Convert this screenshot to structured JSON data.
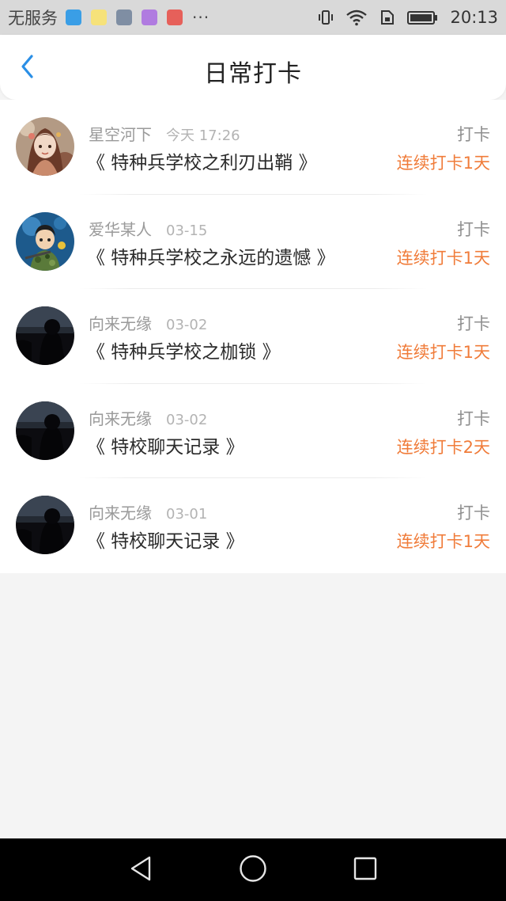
{
  "status_bar": {
    "carrier": "无服务",
    "more": "···",
    "time": "20:13",
    "app_icons": [
      {
        "name": "health-app-icon",
        "color": "#3a9ee6"
      },
      {
        "name": "ai-assistant-app-icon",
        "color": "#f6e27a"
      },
      {
        "name": "gallery-app-icon",
        "color": "#7f8ea3"
      },
      {
        "name": "keyboard-app-icon",
        "color": "#b07be0"
      },
      {
        "name": "red-app-icon",
        "color": "#e6605a"
      }
    ]
  },
  "header": {
    "title": "日常打卡",
    "back_icon": "chevron-left-icon",
    "accent_color": "#2b8fe6"
  },
  "colors": {
    "streak": "#f07c3a",
    "title": "#2b2b2b",
    "meta": "#9a9a9a"
  },
  "entries": [
    {
      "username": "星空河下",
      "time": "今天 17:26",
      "book_title": "《 特种兵学校之利刃出鞘 》",
      "label": "打卡",
      "streak": "连续打卡1天",
      "avatar": "anime-girl-avatar"
    },
    {
      "username": "爱华某人",
      "time": "03-15",
      "book_title": "《 特种兵学校之永远的遗憾 》",
      "label": "打卡",
      "streak": "连续打卡1天",
      "avatar": "cartoon-soldier-avatar"
    },
    {
      "username": "向来无缘",
      "time": "03-02",
      "book_title": "《 特种兵学校之枷锁 》",
      "label": "打卡",
      "streak": "连续打卡1天",
      "avatar": "dark-silhouette-avatar"
    },
    {
      "username": "向来无缘",
      "time": "03-02",
      "book_title": "《 特校聊天记录 》",
      "label": "打卡",
      "streak": "连续打卡2天",
      "avatar": "dark-silhouette-avatar"
    },
    {
      "username": "向来无缘",
      "time": "03-01",
      "book_title": "《 特校聊天记录 》",
      "label": "打卡",
      "streak": "连续打卡1天",
      "avatar": "dark-silhouette-avatar"
    }
  ],
  "nav_bar": {
    "back": "triangle-back-icon",
    "home": "circle-home-icon",
    "recents": "square-recents-icon"
  }
}
